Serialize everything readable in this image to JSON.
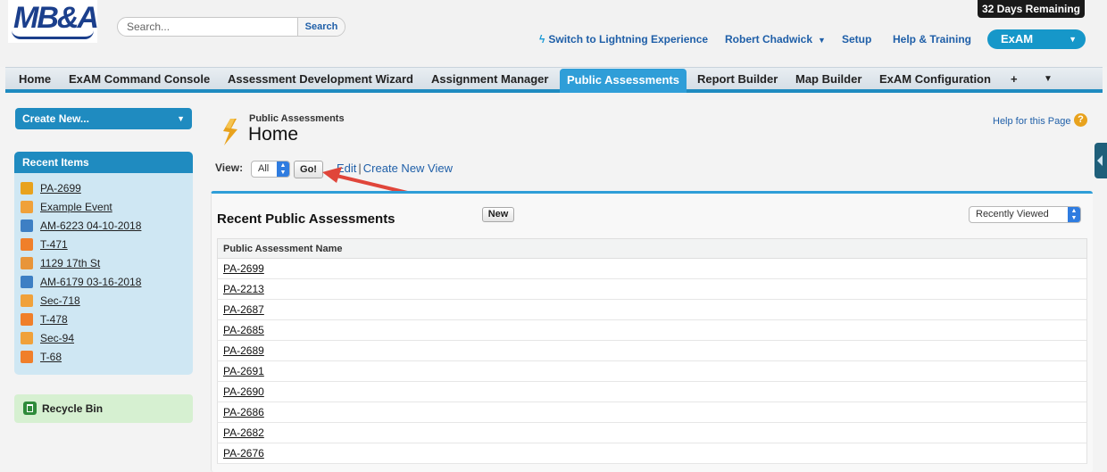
{
  "header": {
    "logo_text": "MB&A",
    "search_placeholder": "Search...",
    "search_button": "Search",
    "trial_badge": "32 Days Remaining",
    "lightning_link": "Switch to Lightning Experience",
    "user_menu": "Robert Chadwick",
    "setup": "Setup",
    "help_training": "Help & Training",
    "app_switcher": "ExAM"
  },
  "tabs": [
    {
      "label": "Home"
    },
    {
      "label": "ExAM Command Console"
    },
    {
      "label": "Assessment Development Wizard"
    },
    {
      "label": "Assignment Manager"
    },
    {
      "label": "Public Assessments",
      "active": true
    },
    {
      "label": "Report Builder"
    },
    {
      "label": "Map Builder"
    },
    {
      "label": "ExAM Configuration"
    },
    {
      "label": "+"
    },
    {
      "label": "▼"
    }
  ],
  "sidebar": {
    "create_new": "Create New...",
    "recent_title": "Recent Items",
    "recent_items": [
      {
        "label": "PA-2699",
        "icon": "assessment-icon",
        "color": "#e8a21d"
      },
      {
        "label": "Example Event",
        "icon": "event-icon",
        "color": "#f0a13a"
      },
      {
        "label": "AM-6223 04-10-2018",
        "icon": "assignment-icon",
        "color": "#3d7fc4"
      },
      {
        "label": "T-471",
        "icon": "box-icon",
        "color": "#f07f2a"
      },
      {
        "label": "1129 17th St",
        "icon": "building-icon",
        "color": "#e8953a"
      },
      {
        "label": "AM-6179 03-16-2018",
        "icon": "assignment-icon",
        "color": "#3d7fc4"
      },
      {
        "label": "Sec-718",
        "icon": "section-icon",
        "color": "#f0a13a"
      },
      {
        "label": "T-478",
        "icon": "box-icon",
        "color": "#f07f2a"
      },
      {
        "label": "Sec-94",
        "icon": "section-icon",
        "color": "#f0a13a"
      },
      {
        "label": "T-68",
        "icon": "box-icon",
        "color": "#f07f2a"
      }
    ],
    "recycle_bin": "Recycle Bin"
  },
  "main": {
    "kicker": "Public Assessments",
    "title": "Home",
    "help_link": "Help for this Page",
    "help_icon_glyph": "?",
    "view_label": "View:",
    "view_value": "All",
    "go_button": "Go!",
    "edit_link": "Edit",
    "separator": "|",
    "create_view_link": "Create New View",
    "list_title": "Recent Public Assessments",
    "new_button": "New",
    "sort_value": "Recently Viewed",
    "column_header": "Public Assessment Name",
    "rows": [
      "PA-2699",
      "PA-2213",
      "PA-2687",
      "PA-2685",
      "PA-2689",
      "PA-2691",
      "PA-2690",
      "PA-2686",
      "PA-2682",
      "PA-2676"
    ]
  },
  "colors": {
    "accent": "#1f8bc0",
    "active_tab": "#2f9ed8",
    "annotation_arrow": "#e0453a"
  }
}
